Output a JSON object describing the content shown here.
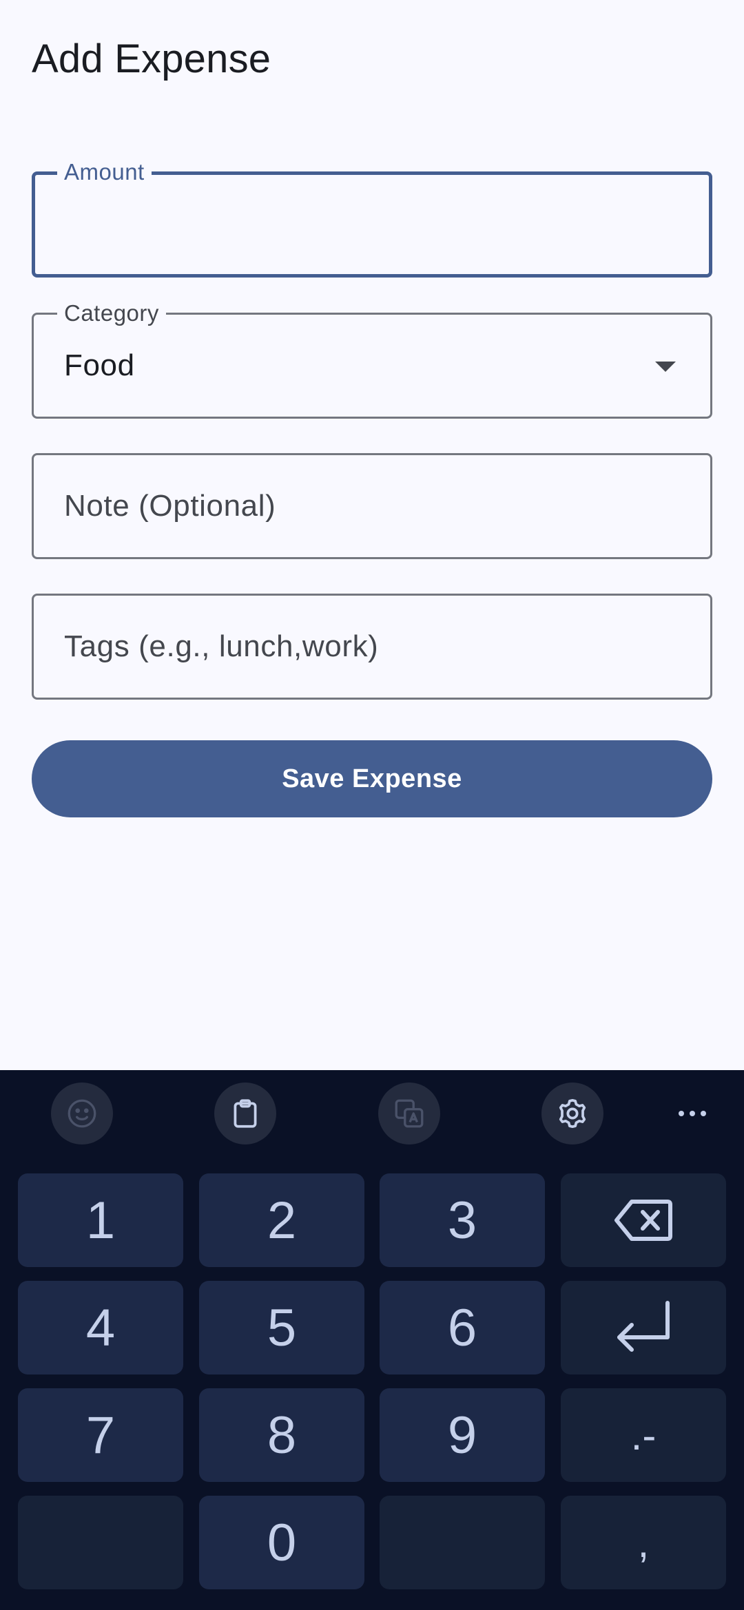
{
  "header": {
    "title": "Add Expense"
  },
  "form": {
    "amount": {
      "label": "Amount",
      "value": ""
    },
    "category": {
      "label": "Category",
      "value": "Food"
    },
    "note": {
      "placeholder": "Note (Optional)"
    },
    "tags": {
      "placeholder": "Tags (e.g., lunch,work)"
    },
    "save_label": "Save Expense"
  },
  "keyboard": {
    "toolbar": [
      "emoji-icon",
      "clipboard-icon",
      "translate-icon",
      "gear-icon",
      "more-icon"
    ],
    "keys": {
      "k1": "1",
      "k2": "2",
      "k3": "3",
      "k4": "4",
      "k5": "5",
      "k6": "6",
      "k7": "7",
      "k8": "8",
      "k9": "9",
      "k0": "0",
      "dot_dash": ".-",
      "comma": ","
    }
  },
  "colors": {
    "primary": "#445e91",
    "background": "#f9f9ff",
    "keyboard_bg": "#0a1126",
    "key_bg": "#1d2948",
    "key_text": "#c5d0ea"
  }
}
